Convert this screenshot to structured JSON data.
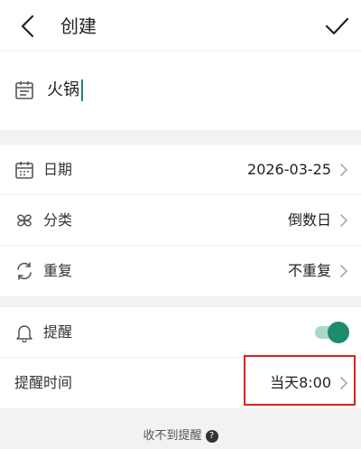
{
  "header": {
    "title": "创建",
    "back_icon": "chevron-left-icon",
    "confirm_icon": "checkmark-icon"
  },
  "name_field": {
    "value": "火锅",
    "icon": "note-icon",
    "caret_color": "#1e8a6e"
  },
  "rows": {
    "date": {
      "label": "日期",
      "value": "2026-03-25",
      "icon": "calendar-icon"
    },
    "category": {
      "label": "分类",
      "value": "倒数日",
      "icon": "clover-icon"
    },
    "repeat": {
      "label": "重复",
      "value": "不重复",
      "icon": "repeat-icon"
    },
    "reminder": {
      "label": "提醒",
      "icon": "bell-icon",
      "enabled": true
    },
    "reminder_time": {
      "label": "提醒时间",
      "value": "当天8:00"
    }
  },
  "footer": {
    "help_text": "收不到提醒",
    "help_icon_glyph": "?"
  },
  "colors": {
    "accent": "#1e8a6e",
    "accent_light": "#a7d8c8",
    "highlight": "#e02020",
    "section_bg": "#f2f2f2"
  }
}
